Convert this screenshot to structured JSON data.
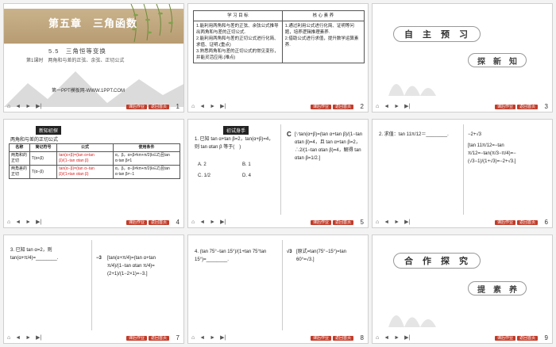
{
  "slides": [
    {
      "number": "1",
      "chapter": "第五章　三角函数",
      "section": "5.5　三角恒等变换",
      "lesson": "第1课时　两角和与差的正弦、余弦、正切公式",
      "site": "第一PPT模板网-WWW.1PPT.COM"
    },
    {
      "number": "2",
      "headers": [
        "学 习 目 标",
        "核 心 素 养"
      ],
      "goals": [
        "1.能利用两角和与差的正弦、余弦公式推导出两角和与差的正切公式.",
        "2.能利用两角和与差的正切公式进行化简、求值、证明.(重点)",
        "3.熟悉两角和与差的正切公式的常见变形，并能灵活应用.(难点)"
      ],
      "literacy": [
        "1.通过利用公式进行化简、证明等问题，培养逻辑推理素养.",
        "2.借助公式进行求值，提升数学运算素养."
      ]
    },
    {
      "number": "3",
      "pill": [
        "自",
        "主",
        "预",
        "习"
      ],
      "sub": [
        "探",
        "新",
        "知"
      ]
    },
    {
      "number": "4",
      "tag": "新知初探",
      "lead": "两角和与差的正切公式",
      "cols": [
        "名称",
        "简记符号",
        "公式",
        "使用条件"
      ],
      "rows": [
        [
          "两角和的正切",
          "T(α+β)",
          "tan(α+β)=(tan α+tan β)/(1−tan αtan β)",
          "α，β，α+β≠kπ+π/2(k∈Z)且tan α·tan β≠1"
        ],
        [
          "两角差的正切",
          "T(α−β)",
          "tan(α−β)=(tan α−tan β)/(1+tan αtan β)",
          "α，β，α−β≠kπ+π/2(k∈Z)且tan α·tan β≠−1"
        ]
      ]
    },
    {
      "number": "5",
      "tag": "初试身手",
      "q": "1. 已知 tan α+tan β=2，tan(α+β)=4，则 tan αtan β 等于(　)",
      "options": [
        "A. 2",
        "B. 1",
        "C. 1/2",
        "D. 4"
      ],
      "answer": "C",
      "sol": "[∵tan(α+β)=(tan α+tan β)/(1−tan αtan β)=4，且 tan α+tan β=2，∴2/(1−tan αtan β)=4，解得 tan αtan β=1/2.]"
    },
    {
      "number": "6",
      "q": "2. 求值：tan 11π/12＝________.",
      "answer": "−2+√3",
      "sol": "[tan 11π/12=−tan π/12=−tan(π/3−π/4)=−(√3−1)/(1+√3)=−2+√3.]"
    },
    {
      "number": "7",
      "q": "3. 已知 tan α=2，则 tan(α+π/4)=________.",
      "answer": "−3",
      "sol": "[tan(α+π/4)=(tan α+tan π/4)/(1−tan αtan π/4)=(2+1)/(1−2×1)=−3.]"
    },
    {
      "number": "8",
      "q": "4. (tan 75°−tan 15°)/(1+tan 75°tan 15°)=________.",
      "answer": "√3",
      "sol": "[原式=tan(75°−15°)=tan 60°=√3.]"
    },
    {
      "number": "9",
      "pill": [
        "合",
        "作",
        "探",
        "究"
      ],
      "sub": [
        "提",
        "素",
        "养"
      ]
    }
  ],
  "icons": [
    "home-icon",
    "back-icon",
    "forward-icon",
    "end-icon"
  ],
  "nav": [
    "课后作业",
    "返回首页"
  ]
}
